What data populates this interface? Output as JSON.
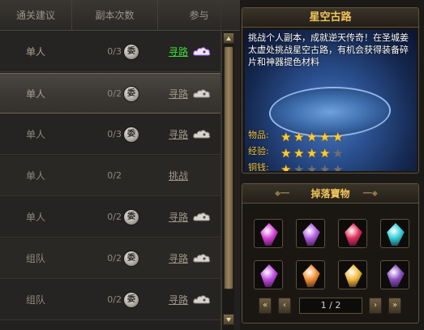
{
  "table": {
    "headers": [
      "通关建议",
      "副本次数",
      "参与"
    ],
    "rows": [
      {
        "type": "单人",
        "count": "0/3",
        "delegate": "委",
        "action": "寻路",
        "action_color": "#3bd93b",
        "cloud": true,
        "selected": false
      },
      {
        "type": "单人",
        "count": "0/2",
        "delegate": "委",
        "action": "寻路",
        "action_color": "#9d9689",
        "cloud": true,
        "selected": true
      },
      {
        "type": "单人",
        "count": "0/3",
        "delegate": "委",
        "action": "寻路",
        "action_color": "#9d9689",
        "cloud": true,
        "selected": false
      },
      {
        "type": "单人",
        "count": "0/2",
        "delegate": "",
        "action": "挑战",
        "action_color": "#9d9689",
        "cloud": false,
        "selected": false
      },
      {
        "type": "单人",
        "count": "0/2",
        "delegate": "委",
        "action": "寻路",
        "action_color": "#9d9689",
        "cloud": true,
        "selected": false
      },
      {
        "type": "组队",
        "count": "0/2",
        "delegate": "委",
        "action": "寻路",
        "action_color": "#9d9689",
        "cloud": true,
        "selected": false
      },
      {
        "type": "组队",
        "count": "0/2",
        "delegate": "委",
        "action": "寻路",
        "action_color": "#9d9689",
        "cloud": true,
        "selected": false
      }
    ]
  },
  "dungeon": {
    "title": "星空古路",
    "description": "挑战个人副本，成就逆天传奇！在圣城姜太虚处挑战星空古路，有机会获得装备碎片和神器提色材料",
    "stats": [
      {
        "label": "物品:",
        "stars": 5,
        "max": 5
      },
      {
        "label": "经验:",
        "stars": 4,
        "max": 5
      },
      {
        "label": "铜钱:",
        "stars": 1,
        "max": 5
      }
    ]
  },
  "drops": {
    "title": "掉落寶物",
    "items": [
      {
        "icon": "purple-heart-gem-icon",
        "color": "#d63fd6"
      },
      {
        "icon": "purple-crystal-icon",
        "color": "#b25adf"
      },
      {
        "icon": "red-cube-gem-icon",
        "color": "#e0305a"
      },
      {
        "icon": "cyan-crystal-icon",
        "color": "#2fd0d8"
      },
      {
        "icon": "violet-crystal-icon",
        "color": "#c04be0"
      },
      {
        "icon": "orange-crystal-icon",
        "color": "#f09030"
      },
      {
        "icon": "amber-crystal-icon",
        "color": "#f0b838"
      },
      {
        "icon": "purple-chest-icon",
        "color": "#8a4ec0"
      }
    ],
    "page": "1 / 2"
  }
}
